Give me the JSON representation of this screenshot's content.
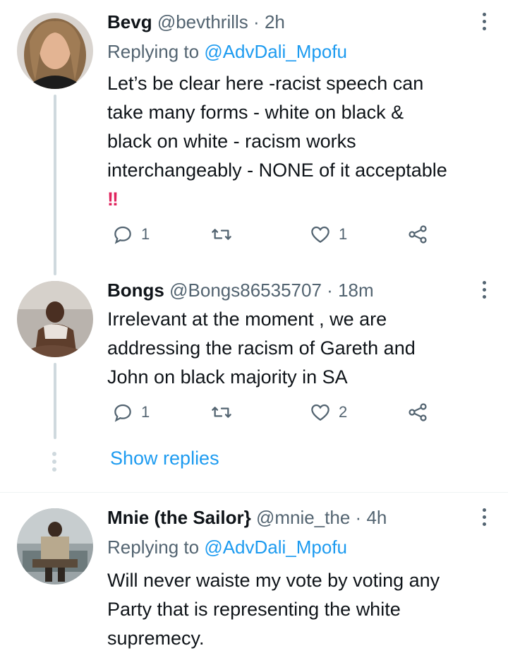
{
  "tweets": [
    {
      "name": "Bevg",
      "handle": "@bevthrills",
      "dot": "·",
      "time": "2h",
      "replying_prefix": "Replying to ",
      "replying_mention": "@AdvDali_Mpofu",
      "text": "Let’s be clear here -racist speech can\ntake many forms - white on black &\nblack on white - racism works\ninterchangeably - NONE of it acceptable",
      "emoji": "!!",
      "replies": "1",
      "retweets": "",
      "likes": "1"
    },
    {
      "name": "Bongs",
      "handle": "@Bongs86535707",
      "dot": "·",
      "time": "18m",
      "text": "Irrelevant at the moment , we are\naddressing the racism of Gareth and\nJohn on black majority in SA",
      "replies": "1",
      "retweets": "",
      "likes": "2"
    },
    {
      "name": "Mnie (the Sailor}",
      "handle": "@mnie_the",
      "dot": "·",
      "time": "4h",
      "replying_prefix": "Replying to ",
      "replying_mention": "@AdvDali_Mpofu",
      "text": "Will never waiste my vote by voting any\nParty that is representing the white\nsupremecy."
    }
  ],
  "show_replies": "Show replies",
  "colors": {
    "link": "#1d9bf0",
    "muted": "#536471",
    "line": "#cfd9de",
    "alert": "#e0245e"
  }
}
